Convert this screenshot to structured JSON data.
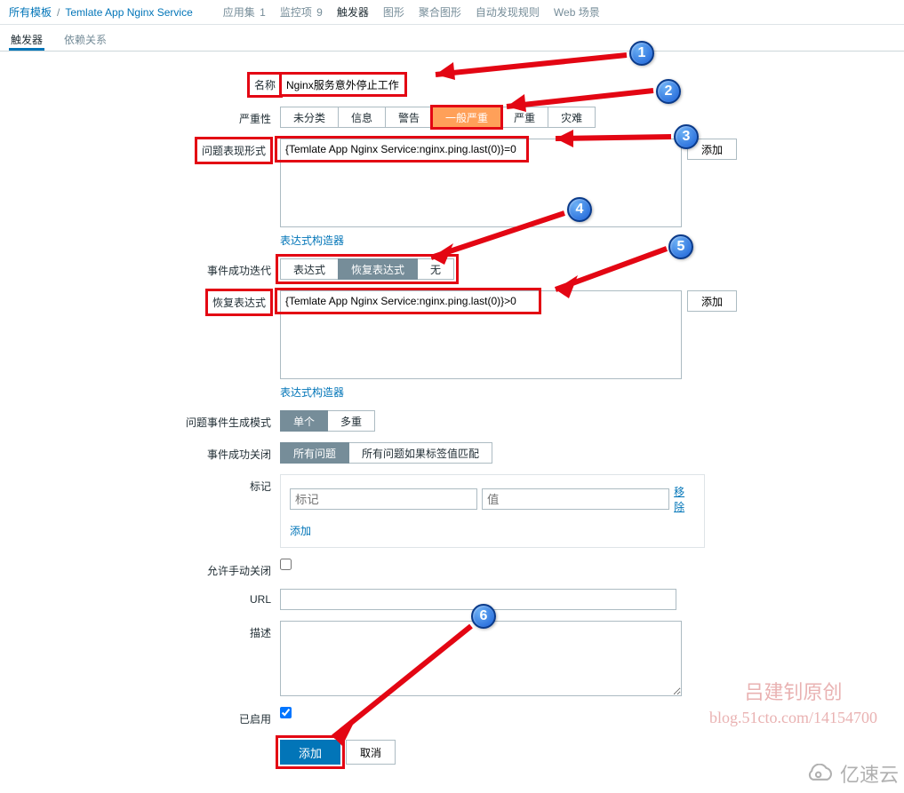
{
  "breadcrumb": {
    "all_templates": "所有模板",
    "template_name": "Temlate App Nginx Service",
    "items": [
      {
        "label": "应用集",
        "count": "1"
      },
      {
        "label": "监控项",
        "count": "9"
      },
      {
        "label": "触发器",
        "count": "",
        "selected": true
      },
      {
        "label": "图形",
        "count": ""
      },
      {
        "label": "聚合图形",
        "count": ""
      },
      {
        "label": "自动发现规则",
        "count": ""
      },
      {
        "label": "Web 场景",
        "count": ""
      }
    ]
  },
  "subtabs": {
    "trigger": "触发器",
    "dependency": "依赖关系"
  },
  "labels": {
    "name": "名称",
    "severity": "严重性",
    "problem_expr": "问题表现形式",
    "expr_builder": "表达式构造器",
    "ok_event_gen": "事件成功迭代",
    "recovery_expr": "恢复表达式",
    "problem_event_gen_mode": "问题事件生成模式",
    "ok_event_closes": "事件成功关闭",
    "tags": "标记",
    "allow_manual_close": "允许手动关闭",
    "url": "URL",
    "description": "描述",
    "enabled": "已启用"
  },
  "values": {
    "name": "Nginx服务意外停止工作",
    "problem_expr": "{Temlate App Nginx Service:nginx.ping.last(0)}=0",
    "recovery_expr": "{Temlate App Nginx Service:nginx.ping.last(0)}>0",
    "url": "",
    "description": "",
    "enabled": true,
    "allow_manual_close": false
  },
  "severity_opts": [
    "未分类",
    "信息",
    "警告",
    "一般严重",
    "严重",
    "灾难"
  ],
  "ok_event_opts": [
    "表达式",
    "恢复表达式",
    "无"
  ],
  "problem_event_mode_opts": [
    "单个",
    "多重"
  ],
  "ok_close_opts": [
    "所有问题",
    "所有问题如果标签值匹配"
  ],
  "buttons": {
    "add": "添加",
    "cancel": "取消",
    "add_row": "添加",
    "remove": "移除"
  },
  "placeholders": {
    "tag_name": "标记",
    "tag_value": "值"
  },
  "watermark": {
    "line1": "吕建钊原创",
    "line2": "blog.51cto.com/14154700",
    "brand": "亿速云"
  },
  "badges": [
    "1",
    "2",
    "3",
    "4",
    "5",
    "6"
  ]
}
